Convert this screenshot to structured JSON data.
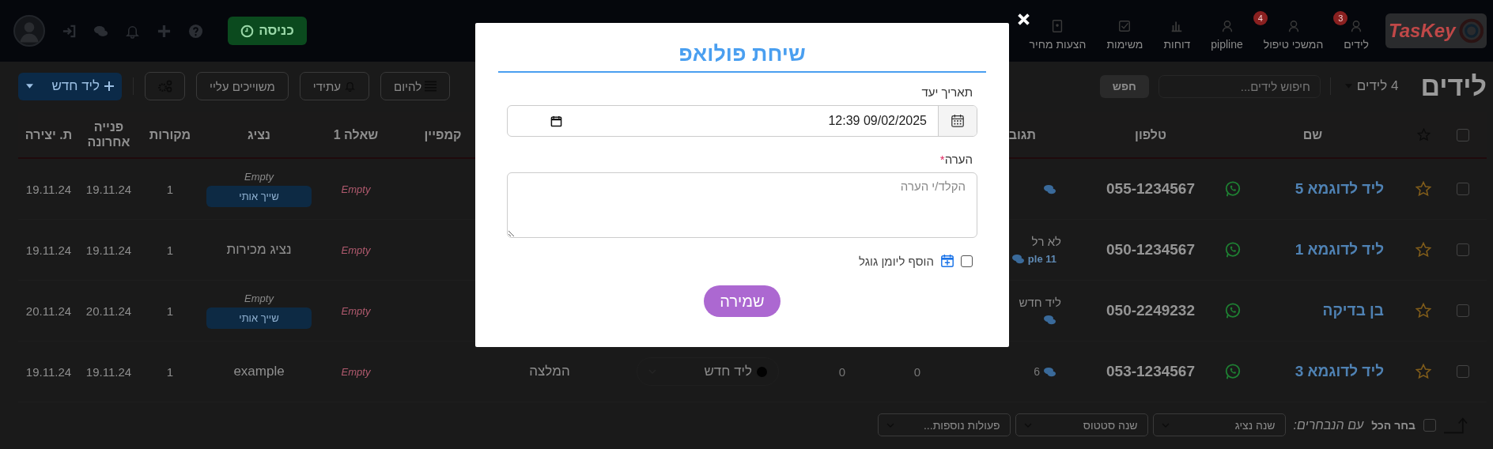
{
  "navbar": {
    "logo": "TasKey",
    "items": [
      {
        "label": "לידים",
        "kind": "person",
        "badge": "3"
      },
      {
        "label": "המשכי טיפול",
        "kind": "person",
        "badge": "4"
      },
      {
        "label": "pipline",
        "kind": "person"
      },
      {
        "label": "דוחות",
        "kind": "chart"
      },
      {
        "label": "משימות",
        "kind": "check"
      },
      {
        "label": "הצעות מחיר",
        "kind": "doc"
      }
    ],
    "checkin_button": "כניסה"
  },
  "toolbar": {
    "title": "לידים",
    "count_dropdown": "4 לידים",
    "search": {
      "placeholder": "חיפוש לידים..."
    },
    "search_button": "חפש",
    "new_lead_button": "ליד חדש",
    "filters": [
      {
        "label": "להיום",
        "kind": "list"
      },
      {
        "label": "עתידי",
        "kind": "bell"
      },
      {
        "label": "משוייכים עליי",
        "kind": "plain"
      }
    ]
  },
  "table": {
    "header_checkbox": {
      "checked": false
    },
    "header": {
      "name": "שם",
      "phone": "טלפון",
      "comments": "תגוב",
      "campaign": "קמפיין",
      "question": "שאלה 1",
      "agent": "נציג",
      "sources": "מקורות",
      "last_contact": "פנייה אחרונה",
      "created": "ת. יצירה"
    },
    "rows": [
      {
        "checked": false,
        "starred": false,
        "name": "ליד לדוגמא 5",
        "phone": "055-1234567",
        "chat_icon": true,
        "question": "Empty",
        "agent": {
          "name": "Empty",
          "empty": true,
          "assign_button": "שייך אותי"
        },
        "sources": "1",
        "last_contact": "19.11.24",
        "created": "19.11.24"
      },
      {
        "checked": false,
        "starred": false,
        "name": "ליד לדוגמא 1",
        "phone": "050-1234567",
        "comment_text": "לא רל",
        "comment_author": "ple 11",
        "chat_icon": true,
        "question": "Empty",
        "agent": {
          "name": "נציג מכירות",
          "empty": false
        },
        "sources": "1",
        "last_contact": "19.11.24",
        "created": "19.11.24"
      },
      {
        "checked": false,
        "starred": false,
        "name": "בן בדיקה",
        "phone": "050-2249232",
        "comment_text": "ליד חדש",
        "chat_icon": true,
        "question": "Empty",
        "agent": {
          "name": "Empty",
          "empty": true,
          "assign_button": "שייך אותי"
        },
        "sources": "1",
        "last_contact": "20.11.24",
        "created": "20.11.24"
      },
      {
        "checked": false,
        "starred": false,
        "name": "ליד לדוגמא 3",
        "phone": "053-1234567",
        "comment_count": "6",
        "chat_icon": true,
        "column_6": "0",
        "column_7": "0",
        "status": "ליד חדש",
        "column_9": "המלצה",
        "question": "Empty",
        "agent": {
          "name": "example",
          "empty": false
        },
        "sources": "1",
        "last_contact": "19.11.24",
        "created": "19.11.24"
      }
    ]
  },
  "bulk_actions": {
    "select_all": {
      "label": "בחר הכל",
      "checked": false
    },
    "label": "עם הנבחרים:",
    "selects": [
      "שנה נציג",
      "שנה סטטוס",
      "פעולות נוספות..."
    ]
  },
  "modal": {
    "title": "שיחת פולואפ",
    "date_label": "תאריך יעד",
    "date_value": "09/02/2025 12:39",
    "note_label": "הערה",
    "required_mark": "*",
    "note_placeholder": "הקלד/י הערה",
    "calendar_checkbox": {
      "label": "הוסף ליומן גוגל",
      "checked": false
    },
    "save_button": "שמירה"
  }
}
